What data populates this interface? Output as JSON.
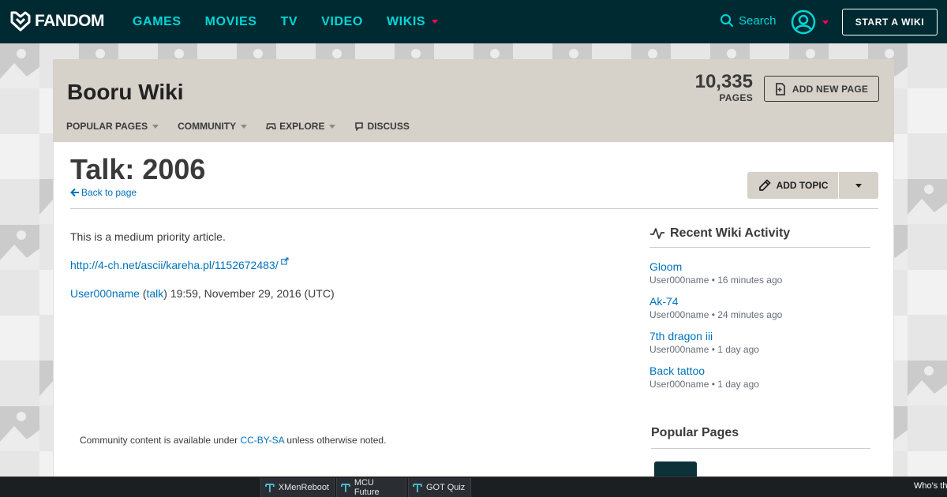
{
  "topnav": {
    "logo_text": "FANDOM",
    "links": [
      {
        "label": "GAMES"
      },
      {
        "label": "MOVIES"
      },
      {
        "label": "TV"
      },
      {
        "label": "VIDEO"
      },
      {
        "label": "WIKIS"
      }
    ],
    "search_label": "Search",
    "start_wiki_label": "START A WIKI"
  },
  "wiki": {
    "title": "Booru Wiki",
    "page_count": "10,335",
    "page_count_label": "PAGES",
    "add_new_page_label": "ADD NEW PAGE",
    "nav": [
      {
        "label": "POPULAR PAGES"
      },
      {
        "label": "COMMUNITY"
      },
      {
        "label": "EXPLORE"
      },
      {
        "label": "DISCUSS"
      }
    ]
  },
  "article": {
    "title": "Talk: 2006",
    "back_label": "Back to page",
    "add_topic_label": "ADD TOPIC",
    "priority_text": "This is a medium priority article.",
    "external_link": "http://4-ch.net/ascii/kareha.pl/1152672483/",
    "signature": {
      "user": "User000name",
      "open_paren": "(",
      "talk": "talk",
      "rest": ") 19:59, November 29, 2016 (UTC)"
    },
    "license_prefix": "Community content is available under ",
    "license_link": "CC-BY-SA",
    "license_suffix": " unless otherwise noted."
  },
  "recent_activity": {
    "heading": "Recent Wiki Activity",
    "items": [
      {
        "title": "Gloom",
        "meta": "User000name • 16 minutes ago"
      },
      {
        "title": "Ak-74",
        "meta": "User000name • 24 minutes ago"
      },
      {
        "title": "7th dragon iii",
        "meta": "User000name • 1 day ago"
      },
      {
        "title": "Back tattoo",
        "meta": "User000name • 1 day ago"
      }
    ]
  },
  "popular_pages": {
    "heading": "Popular Pages"
  },
  "bottom_bar": {
    "tabs": [
      {
        "label": "XMenReboot"
      },
      {
        "label": "MCU Future"
      },
      {
        "label": "GOT Quiz"
      }
    ],
    "right_text": "Who's th"
  },
  "colors": {
    "nav_bg": "#002a32",
    "nav_link": "#00d6d6",
    "accent_caret": "#fa005a",
    "wiki_header_bg": "#d6d1c9",
    "link": "#0072bb"
  }
}
